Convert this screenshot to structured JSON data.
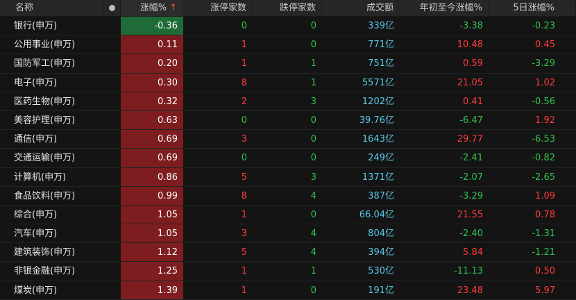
{
  "header": {
    "name": "名称",
    "change": "涨幅%",
    "sort_arrow": "↑",
    "limit_up": "涨停家数",
    "limit_down": "跌停家数",
    "volume": "成交额",
    "ytd": "年初至今涨幅%",
    "five_day": "5日涨幅%"
  },
  "rows": [
    {
      "name": "银行(申万)",
      "change": "-0.36",
      "limit_up": "0",
      "limit_down": "0",
      "volume": "339亿",
      "ytd": "-3.38",
      "five_day": "-0.23"
    },
    {
      "name": "公用事业(申万)",
      "change": "0.11",
      "limit_up": "1",
      "limit_down": "0",
      "volume": "771亿",
      "ytd": "10.48",
      "five_day": "0.45"
    },
    {
      "name": "国防军工(申万)",
      "change": "0.20",
      "limit_up": "1",
      "limit_down": "1",
      "volume": "751亿",
      "ytd": "0.59",
      "five_day": "-3.29"
    },
    {
      "name": "电子(申万)",
      "change": "0.30",
      "limit_up": "8",
      "limit_down": "1",
      "volume": "5571亿",
      "ytd": "21.05",
      "five_day": "1.02"
    },
    {
      "name": "医药生物(申万)",
      "change": "0.32",
      "limit_up": "2",
      "limit_down": "3",
      "volume": "1202亿",
      "ytd": "0.41",
      "five_day": "-0.56"
    },
    {
      "name": "美容护理(申万)",
      "change": "0.63",
      "limit_up": "0",
      "limit_down": "0",
      "volume": "39.76亿",
      "ytd": "-6.47",
      "five_day": "1.92"
    },
    {
      "name": "通信(申万)",
      "change": "0.69",
      "limit_up": "3",
      "limit_down": "0",
      "volume": "1643亿",
      "ytd": "29.77",
      "five_day": "-6.53"
    },
    {
      "name": "交通运输(申万)",
      "change": "0.69",
      "limit_up": "0",
      "limit_down": "0",
      "volume": "249亿",
      "ytd": "-2.41",
      "five_day": "-0.82"
    },
    {
      "name": "计算机(申万)",
      "change": "0.86",
      "limit_up": "5",
      "limit_down": "3",
      "volume": "1371亿",
      "ytd": "-2.07",
      "five_day": "-2.65"
    },
    {
      "name": "食品饮料(申万)",
      "change": "0.99",
      "limit_up": "8",
      "limit_down": "4",
      "volume": "387亿",
      "ytd": "-3.29",
      "five_day": "1.09"
    },
    {
      "name": "综合(申万)",
      "change": "1.05",
      "limit_up": "1",
      "limit_down": "0",
      "volume": "66.04亿",
      "ytd": "21.55",
      "five_day": "0.78"
    },
    {
      "name": "汽车(申万)",
      "change": "1.05",
      "limit_up": "3",
      "limit_down": "4",
      "volume": "804亿",
      "ytd": "-2.40",
      "five_day": "-1.31"
    },
    {
      "name": "建筑装饰(申万)",
      "change": "1.12",
      "limit_up": "5",
      "limit_down": "4",
      "volume": "394亿",
      "ytd": "5.84",
      "five_day": "-1.21"
    },
    {
      "name": "非银金融(申万)",
      "change": "1.25",
      "limit_up": "1",
      "limit_down": "1",
      "volume": "530亿",
      "ytd": "-11.13",
      "five_day": "0.50"
    },
    {
      "name": "煤炭(申万)",
      "change": "1.39",
      "limit_up": "1",
      "limit_down": "0",
      "volume": "191亿",
      "ytd": "23.48",
      "five_day": "5.97"
    }
  ],
  "colors": {
    "up_bg": "#7d1d1f",
    "down_bg": "#1f6b37",
    "red": "#ff3b3b",
    "green": "#32c24d",
    "cyan": "#5bc8e6"
  }
}
